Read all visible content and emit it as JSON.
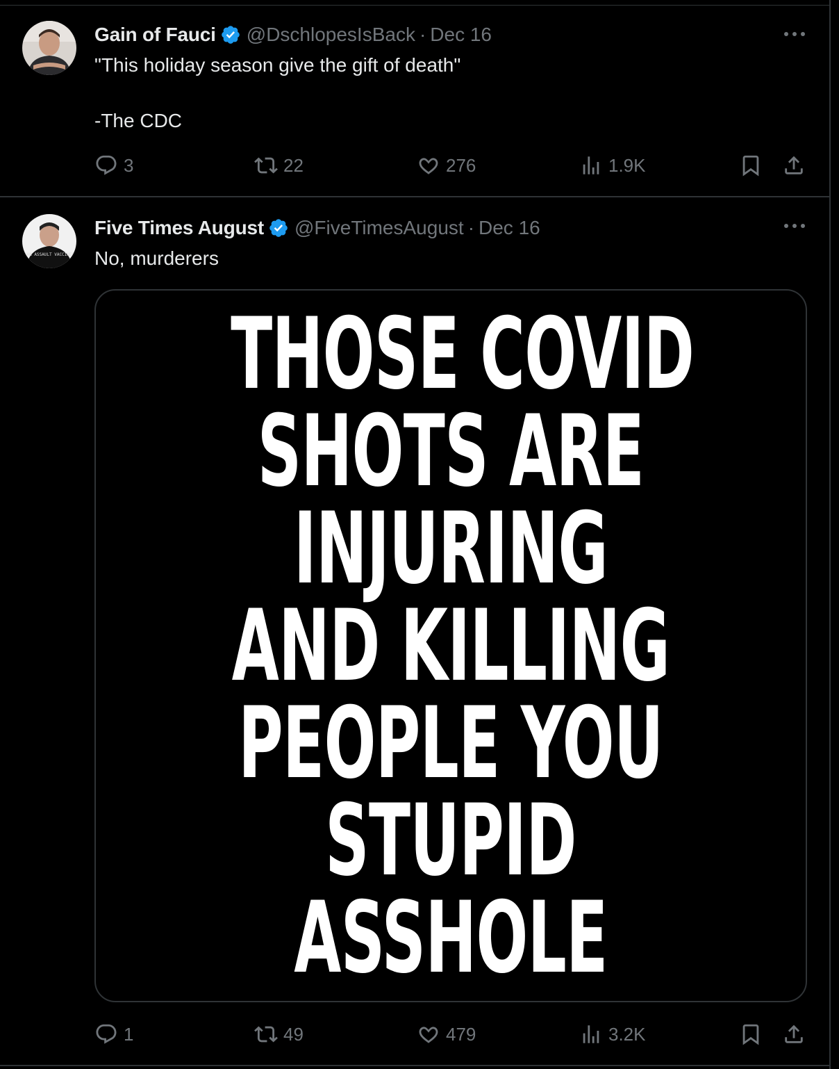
{
  "colors": {
    "background": "#000000",
    "text_primary": "#e7e9ea",
    "text_secondary": "#71767b",
    "verified_badge": "#1d9bf0",
    "border": "#2f3336"
  },
  "tweets": [
    {
      "display_name": "Gain of Fauci",
      "verified": true,
      "handle": "@DschlopesIsBack",
      "separator": "·",
      "date": "Dec 16",
      "text": "\"This holiday season give the gift of death\"\n\n-The CDC",
      "stats": {
        "replies": "3",
        "retweets": "22",
        "likes": "276",
        "views": "1.9K"
      },
      "icons": [
        "more-icon",
        "reply-icon",
        "retweet-icon",
        "like-icon",
        "views-icon",
        "bookmark-icon",
        "share-icon"
      ]
    },
    {
      "display_name": "Five Times August",
      "verified": true,
      "handle": "@FiveTimesAugust",
      "separator": "·",
      "date": "Dec 16",
      "text": "No, murderers",
      "avatar_shirt_text": "BAN ASSAULT VACCINES",
      "media_text_lines": [
        "THOSE COVID",
        "SHOTS ARE",
        "INJURING",
        "AND KILLING",
        "PEOPLE YOU",
        "STUPID",
        "ASSHOLE"
      ],
      "stats": {
        "replies": "1",
        "retweets": "49",
        "likes": "479",
        "views": "3.2K"
      },
      "icons": [
        "more-icon",
        "reply-icon",
        "retweet-icon",
        "like-icon",
        "views-icon",
        "bookmark-icon",
        "share-icon"
      ]
    }
  ]
}
